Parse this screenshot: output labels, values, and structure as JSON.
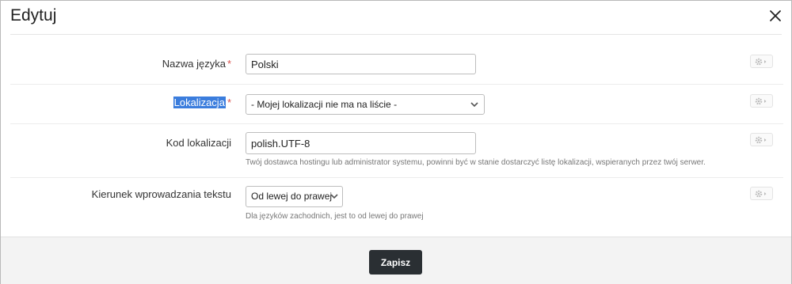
{
  "modal": {
    "title": "Edytuj",
    "close_icon": "close-icon"
  },
  "fields": {
    "language_name": {
      "label": "Nazwa języka",
      "required_marker": "*",
      "value": "Polski"
    },
    "locale": {
      "label": "Lokalizacja",
      "required_marker": "*",
      "selected": "- Mojej lokalizacji nie ma na liście -"
    },
    "locale_code": {
      "label": "Kod lokalizacji",
      "value": "polish.UTF-8",
      "help": "Twój dostawca hostingu lub administrator systemu, powinni być w stanie dostarczyć listę lokalizacji, wspieranych przez twój serwer."
    },
    "text_direction": {
      "label": "Kierunek wprowadzania tekstu",
      "selected": "Od lewej do prawej",
      "help": "Dla języków zachodnich, jest to od lewej do prawej"
    }
  },
  "footer": {
    "save_label": "Zapisz"
  },
  "colors": {
    "required": "#d9534f",
    "label_highlight": "#3b7ddd",
    "save_button": "#2a2f33",
    "footer_bg": "#f3f3f3"
  }
}
